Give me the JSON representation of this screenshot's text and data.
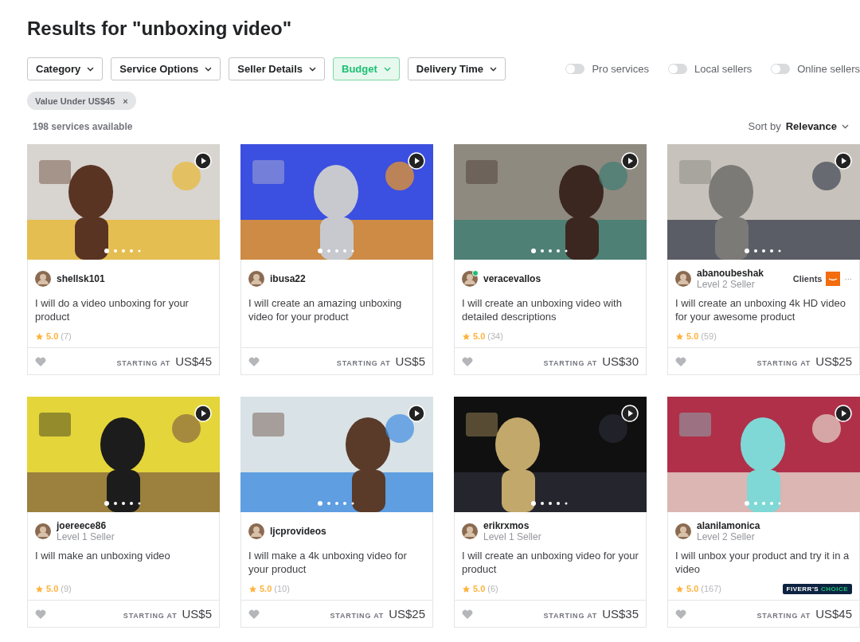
{
  "title": "Results for \"unboxing video\"",
  "filters": [
    {
      "label": "Category",
      "selected": false
    },
    {
      "label": "Service Options",
      "selected": false
    },
    {
      "label": "Seller Details",
      "selected": false
    },
    {
      "label": "Budget",
      "selected": true
    },
    {
      "label": "Delivery Time",
      "selected": false
    }
  ],
  "toggles": [
    {
      "label": "Pro services",
      "on": false
    },
    {
      "label": "Local sellers",
      "on": false
    },
    {
      "label": "Online sellers",
      "on": false
    }
  ],
  "active_filters": [
    {
      "label": "Value Under US$45",
      "remove": "×"
    }
  ],
  "count": "198 services available",
  "sort": {
    "label": "Sort by",
    "value": "Relevance"
  },
  "gigs": [
    {
      "seller": "shellsk101",
      "online": false,
      "title": "I will do a video unboxing for your product",
      "rating": "5.0",
      "reviews": "(7)",
      "price_label": "STARTING AT",
      "price": "US$45"
    },
    {
      "seller": "ibusa22",
      "online": false,
      "title": "I will create an amazing unboxing video for your product",
      "price_label": "STARTING AT",
      "price": "US$5"
    },
    {
      "seller": "veracevallos",
      "online": true,
      "title": "I will create an unboxing video with detailed descriptions",
      "rating": "5.0",
      "reviews": "(34)",
      "price_label": "STARTING AT",
      "price": "US$30"
    },
    {
      "seller": "abanoubeshak",
      "level": "Level 2 Seller",
      "online": false,
      "clients": "Clients",
      "more": "···",
      "title": "I will create an unboxing 4k HD video for your awesome product",
      "rating": "5.0",
      "reviews": "(59)",
      "price_label": "STARTING AT",
      "price": "US$25"
    },
    {
      "seller": "joereece86",
      "level": "Level 1 Seller",
      "online": false,
      "title": "I will make an unboxing video",
      "rating": "5.0",
      "reviews": "(9)",
      "price_label": "STARTING AT",
      "price": "US$5"
    },
    {
      "seller": "ljcprovideos",
      "online": false,
      "title": "I will make a 4k unboxing video for your product",
      "rating": "5.0",
      "reviews": "(10)",
      "price_label": "STARTING AT",
      "price": "US$25"
    },
    {
      "seller": "erikrxmos",
      "level": "Level 1 Seller",
      "online": false,
      "title": "I will create an unboxing video for your product",
      "rating": "5.0",
      "reviews": "(6)",
      "price_label": "STARTING AT",
      "price": "US$35"
    },
    {
      "seller": "alanilamonica",
      "level": "Level 2 Seller",
      "online": false,
      "title": "I will unbox your product and try it in a video",
      "rating": "5.0",
      "reviews": "(167)",
      "badge": {
        "first": "FIVERR'S",
        "second": "CHOICE"
      },
      "price_label": "STARTING AT",
      "price": "US$45"
    }
  ]
}
